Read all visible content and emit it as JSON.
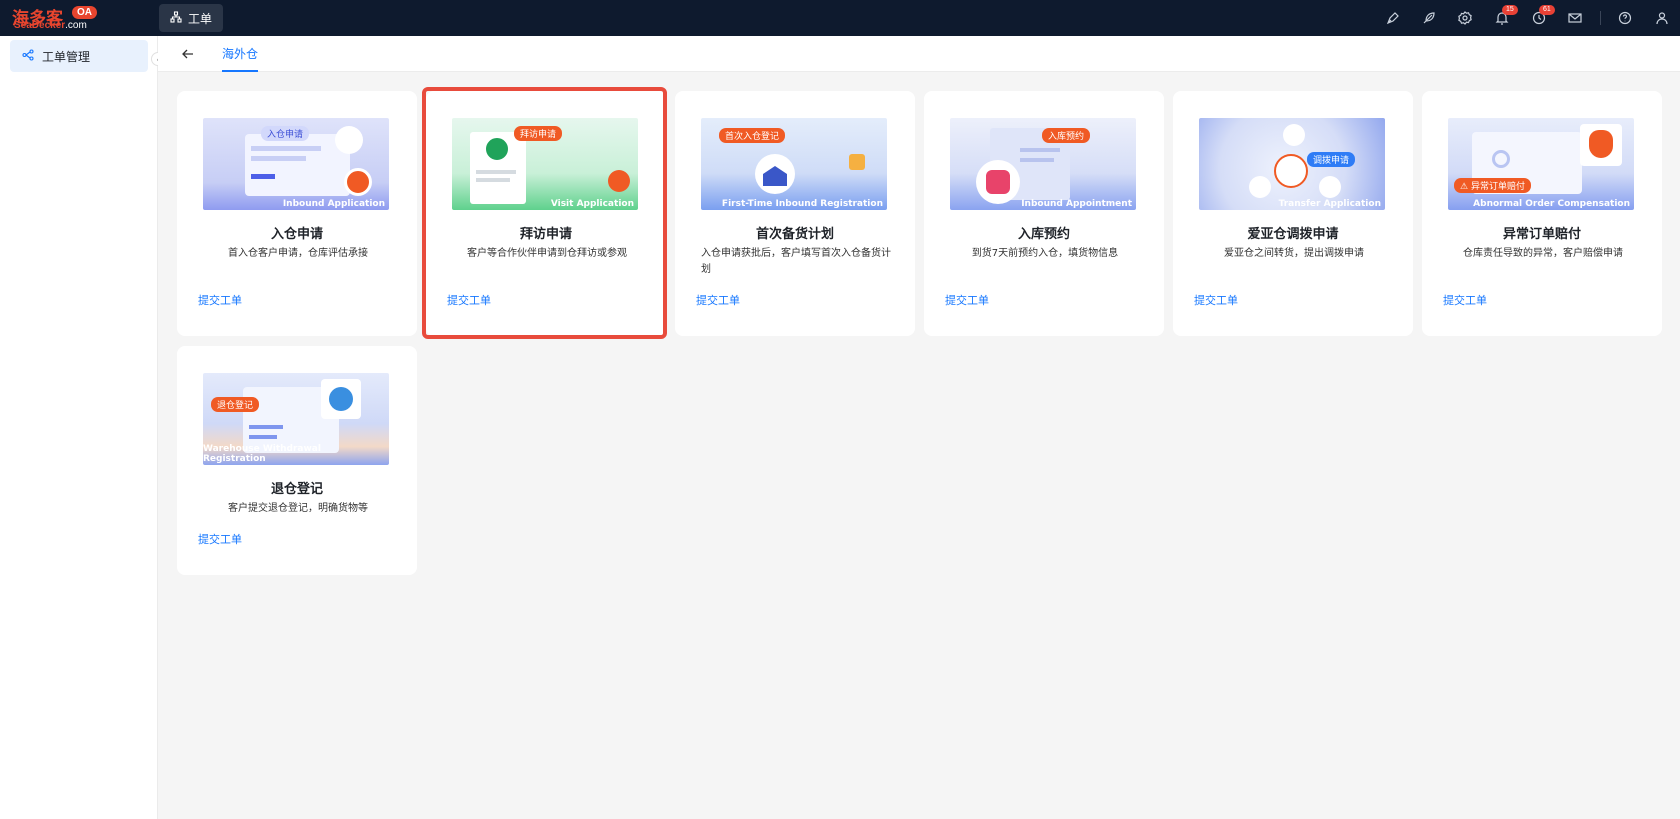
{
  "app": {
    "logo_cn": "海多客",
    "logo_en": "SeaDecker",
    "logo_com": ".com",
    "logo_badge": "OA"
  },
  "topbar": {
    "tab_label": "工单",
    "icons": [
      "pen-icon",
      "feather-icon",
      "settings-icon",
      "bell-icon",
      "clock-icon",
      "mail-icon",
      "help-icon",
      "user-icon"
    ],
    "bell_badge": "15",
    "clock_badge": "61"
  },
  "sidebar": {
    "items": [
      {
        "label": "工单管理"
      }
    ]
  },
  "subheader": {
    "tab": "海外仓"
  },
  "cards": [
    {
      "image_caption": "Inbound Application",
      "image_tag": "入仓申请",
      "title": "入仓申请",
      "desc": "首入仓客户申请，仓库评估承接",
      "link": "提交工单"
    },
    {
      "image_caption": "Visit Application",
      "image_tag": "拜访申请",
      "title": "拜访申请",
      "desc": "客户等合作伙伴申请到仓拜访或参观",
      "link": "提交工单"
    },
    {
      "image_caption": "First-Time Inbound Registration",
      "image_tag": "首次入仓登记",
      "title": "首次备货计划",
      "desc": "入仓申请获批后，客户填写首次入仓备货计划",
      "link": "提交工单"
    },
    {
      "image_caption": "Inbound Appointment",
      "image_tag": "入库预约",
      "title": "入库预约",
      "desc": "到货7天前预约入仓，填货物信息",
      "link": "提交工单"
    },
    {
      "image_caption": "Transfer Application",
      "image_tag": "调拨申请",
      "title": "爱亚仓调拨申请",
      "desc": "爱亚仓之间转货，提出调拨申请",
      "link": "提交工单"
    },
    {
      "image_caption": "Abnormal Order Compensation",
      "image_tag": "异常订单赔付",
      "title": "异常订单赔付",
      "desc": "仓库责任导致的异常，客户赔偿申请",
      "link": "提交工单"
    },
    {
      "image_caption": "Warehouse Withdrawal Registration",
      "image_tag": "退仓登记",
      "title": "退仓登记",
      "desc": "客户提交退仓登记，明确货物等",
      "link": "提交工单"
    }
  ],
  "colors": {
    "topbar": "#0e1a2e",
    "accent": "#1677ff",
    "highlight": "#e84b3c",
    "tag": "#f05a24"
  }
}
